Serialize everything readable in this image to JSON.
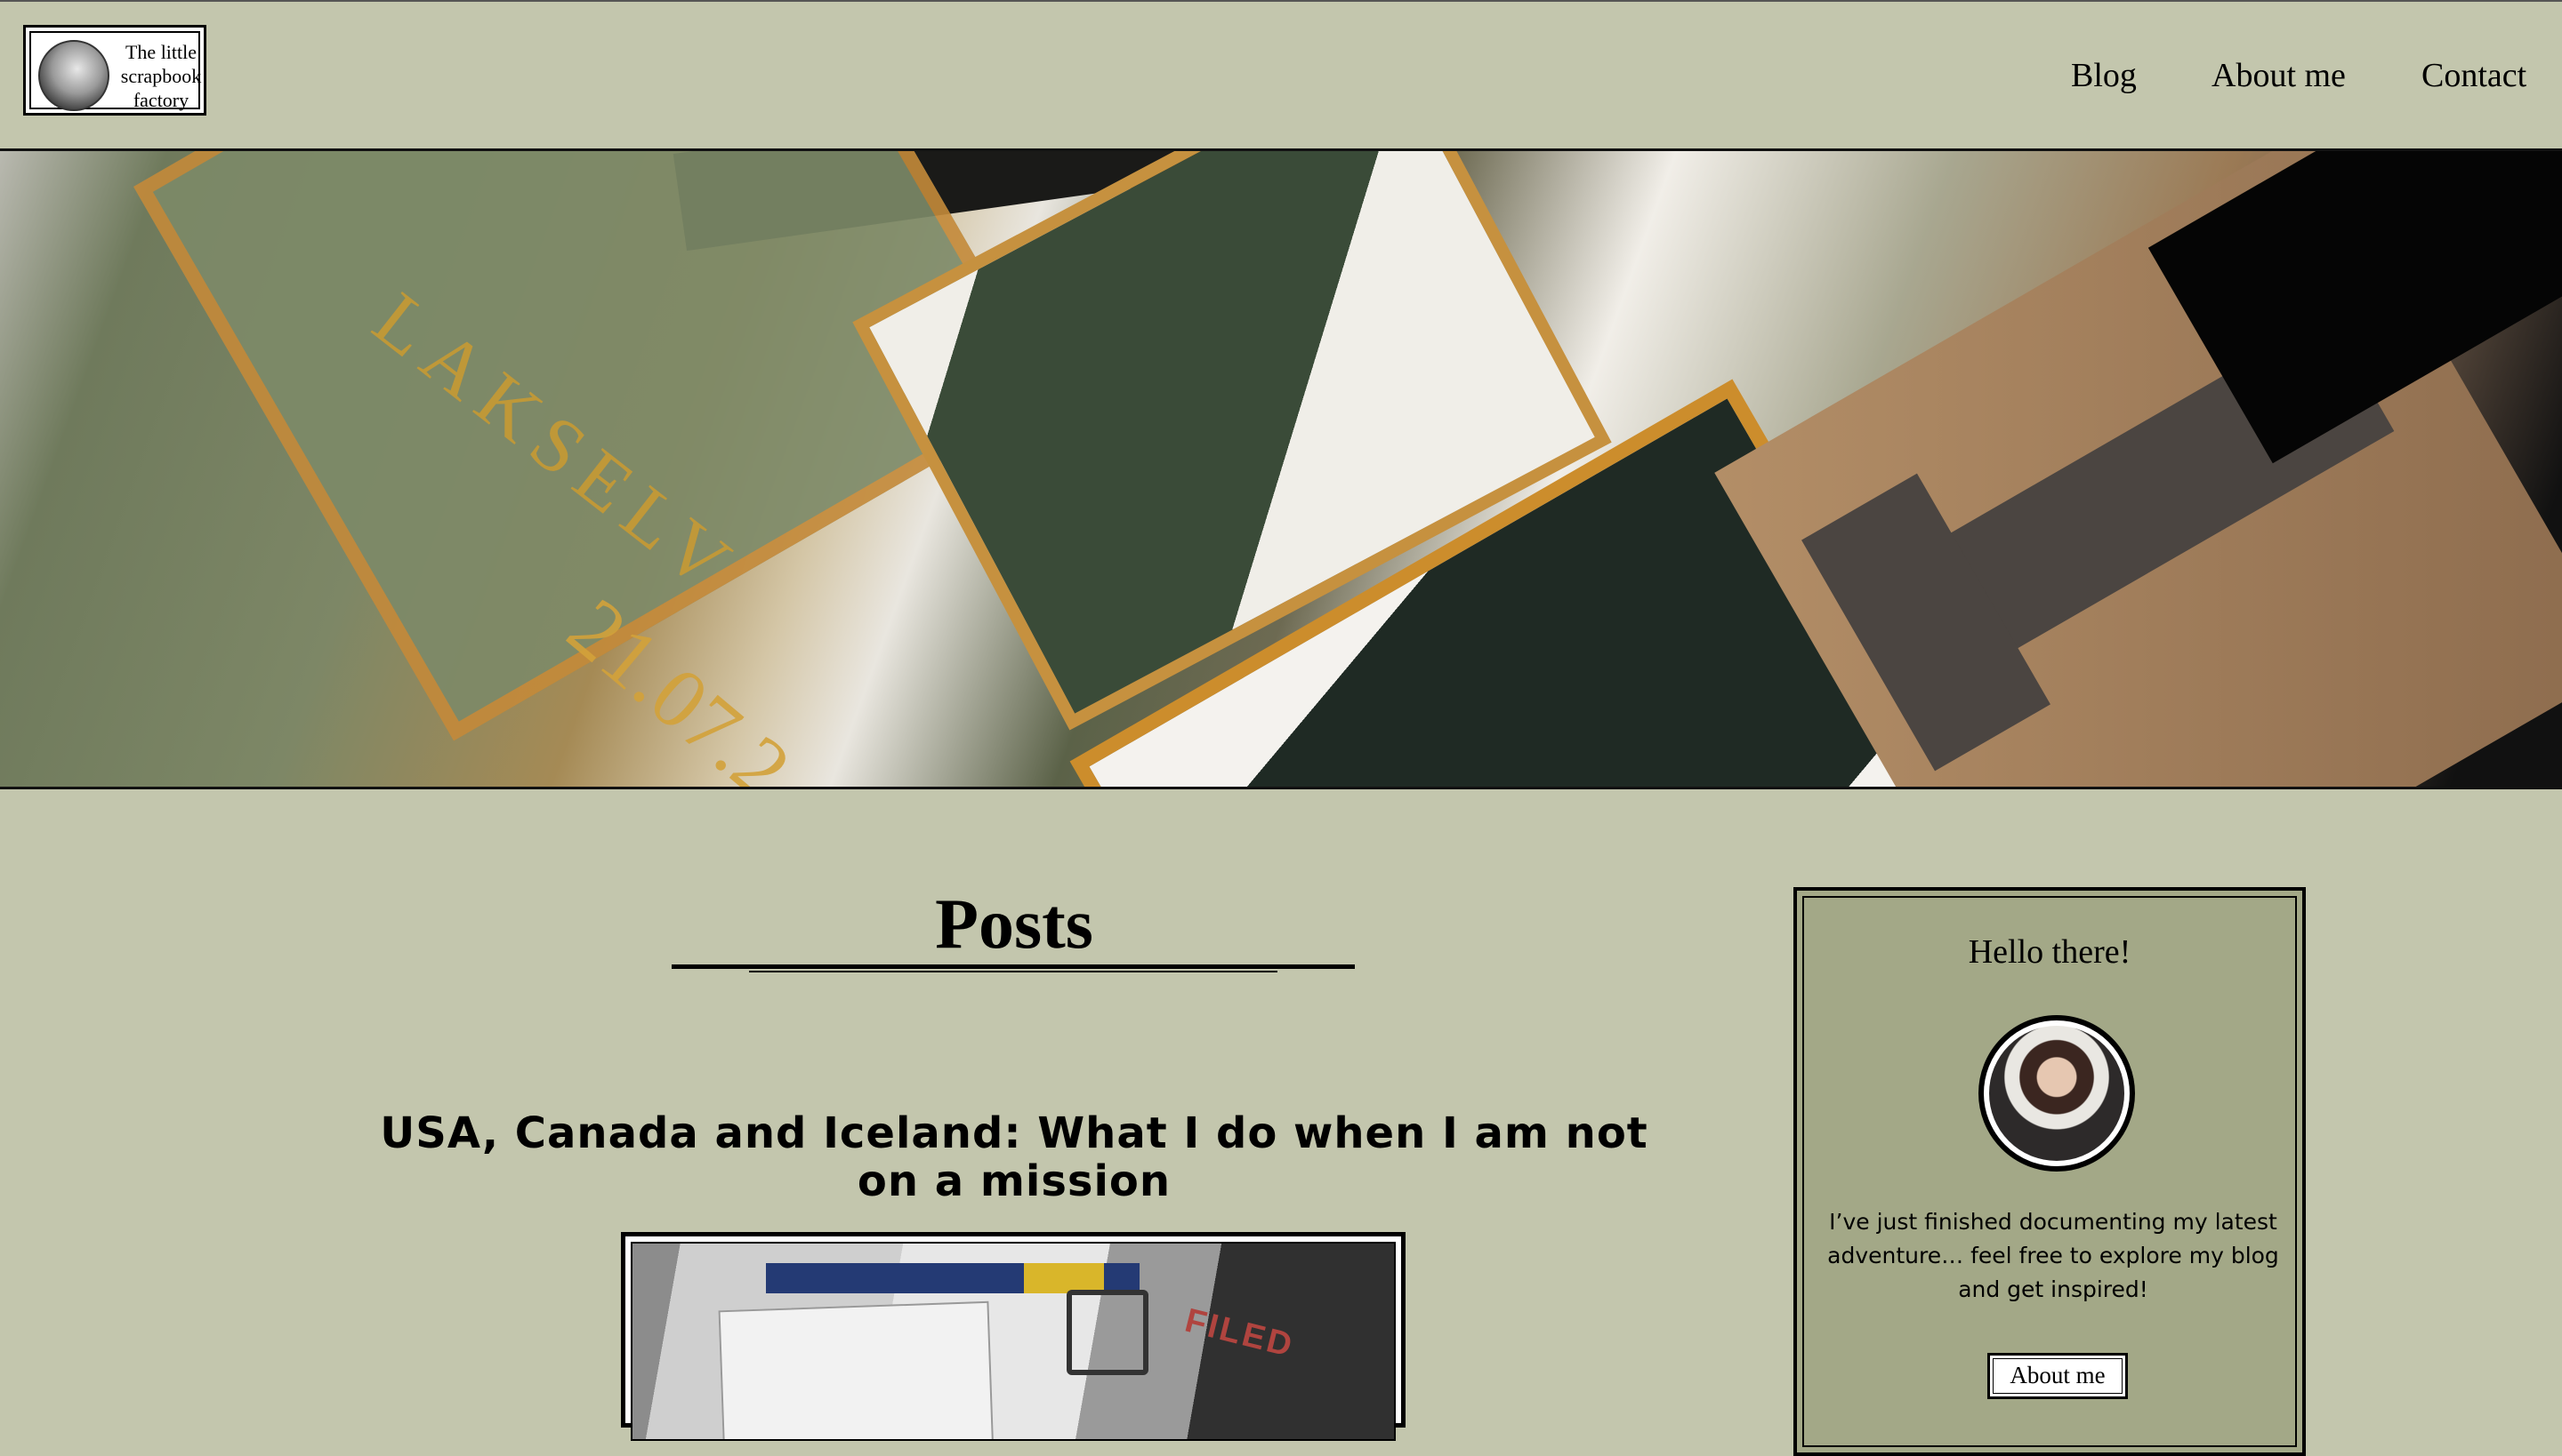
{
  "site": {
    "logo_text": "The little scrapbook factory"
  },
  "nav": {
    "items": [
      "Blog",
      "About me",
      "Contact"
    ]
  },
  "hero": {
    "caption_text": "LAKSELV",
    "caption_date": "21.07.2",
    "photo_label": "FILED",
    "prev_icon": "pointing-hand-left-icon",
    "next_icon": "pointing-hand-right-icon"
  },
  "posts": {
    "heading": "Posts",
    "items": [
      {
        "title": "USA, Canada and Iceland: What I do when I am not on a mission"
      }
    ]
  },
  "sidebar": {
    "title": "Hello there!",
    "text": "I’ve just finished documenting my latest adventure… feel free to explore my blog and get inspired!",
    "button_label": "About me"
  },
  "colors": {
    "page_background": "#c3c6ad",
    "sidebar_background": "#a3a887",
    "accent_gold": "#c79a34"
  }
}
